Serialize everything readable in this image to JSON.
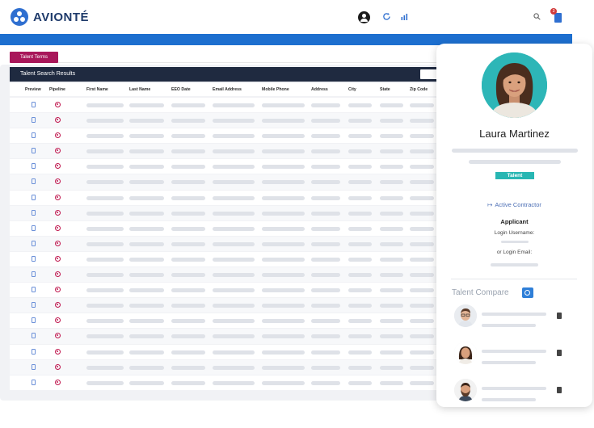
{
  "app": {
    "brand": "AVIONTÉ",
    "notification_count": "3"
  },
  "colors": {
    "brand_blue": "#1d6fcf",
    "tab_magenta": "#a8175a",
    "header_dark": "#1f2a40",
    "talent_teal": "#28b6b3",
    "pipeline_red": "#c0184f"
  },
  "toolbar": {
    "icons": [
      "user-icon",
      "refresh-icon",
      "bar-chart-icon",
      "search-icon",
      "notification-icon"
    ]
  },
  "tab": {
    "label": "Talent Terms"
  },
  "grid": {
    "title": "Talent Search Results",
    "columns": [
      "Preview",
      "Pipeline",
      "First Name",
      "Last Name",
      "EEO Date",
      "Email Address",
      "Mobile Phone",
      "Address",
      "City",
      "State",
      "Zip Code"
    ],
    "row_count": 19
  },
  "profile": {
    "name": "Laura Martinez",
    "badge": "Talent",
    "status_link": "Active Contractor",
    "role": "Applicant",
    "login_username_label": "Login Username:",
    "login_email_label": "or Login Email:"
  },
  "compare": {
    "title": "Talent Compare",
    "entries": [
      {
        "avatar": "man-glasses-avatar"
      },
      {
        "avatar": "woman-avatar"
      },
      {
        "avatar": "bearded-man-avatar"
      }
    ]
  }
}
